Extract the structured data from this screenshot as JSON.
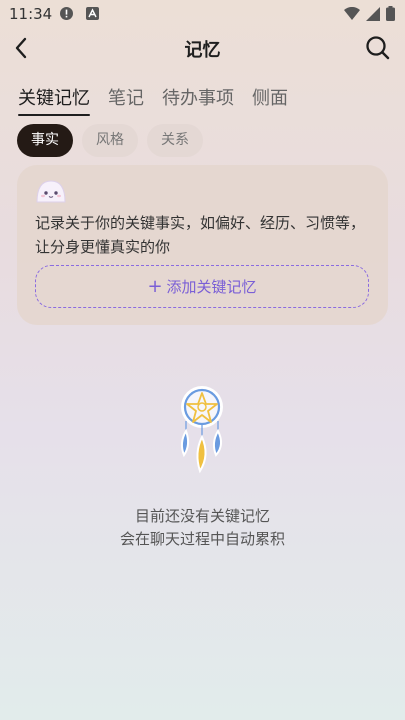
{
  "status_bar": {
    "time": "11:34"
  },
  "nav": {
    "title": "记忆"
  },
  "tabs": [
    {
      "label": "关键记忆",
      "active": true
    },
    {
      "label": "笔记",
      "active": false
    },
    {
      "label": "待办事项",
      "active": false
    },
    {
      "label": "侧面",
      "active": false
    }
  ],
  "chips": [
    {
      "label": "事实",
      "active": true
    },
    {
      "label": "风格",
      "active": false
    },
    {
      "label": "关系",
      "active": false
    }
  ],
  "card": {
    "description": "记录关于你的关键事实，如偏好、经历、习惯等，让分身更懂真实的你",
    "add_button_label": "添加关键记忆"
  },
  "empty_state": {
    "line1": "目前还没有关键记忆",
    "line2": "会在聊天过程中自动累积"
  },
  "colors": {
    "accent": "#7a5fd6",
    "chip_active_bg": "#241a15"
  },
  "icons": [
    "back-arrow-icon",
    "search-icon",
    "ghost-icon",
    "dreamcatcher-icon",
    "plus-icon",
    "wifi-icon",
    "signal-icon",
    "battery-icon"
  ]
}
